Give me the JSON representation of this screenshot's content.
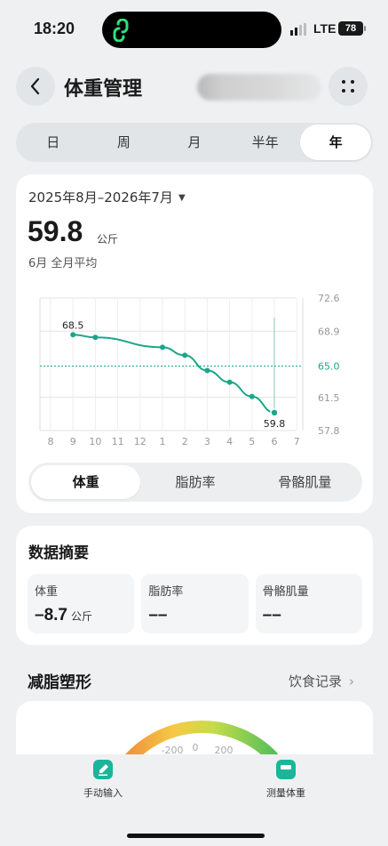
{
  "status_bar": {
    "time": "18:20",
    "network": "LTE",
    "battery": "78"
  },
  "header": {
    "title": "体重管理"
  },
  "period_tabs": [
    {
      "label": "日",
      "active": false
    },
    {
      "label": "周",
      "active": false
    },
    {
      "label": "月",
      "active": false
    },
    {
      "label": "半年",
      "active": false
    },
    {
      "label": "年",
      "active": true
    }
  ],
  "chart_card": {
    "date_range": "2025年8月–2026年7月",
    "value": "59.8",
    "unit": "公斤",
    "value_caption": "6月 全月平均"
  },
  "chart_data": {
    "type": "line",
    "x": [
      "8",
      "9",
      "10",
      "11",
      "12",
      "1",
      "2",
      "3",
      "4",
      "5",
      "6",
      "7"
    ],
    "series": [
      {
        "values": [
          null,
          68.5,
          68.2,
          null,
          null,
          67.1,
          66.2,
          64.5,
          63.2,
          61.6,
          59.8,
          null
        ]
      }
    ],
    "y_ticks": [
      "72.6",
      "68.9",
      "65.0",
      "61.5",
      "57.8"
    ],
    "ylim": [
      57.8,
      72.6
    ],
    "reference_line": {
      "value": 65.0,
      "label": "65.0"
    },
    "point_labels": [
      {
        "x": "9",
        "text": "68.5"
      },
      {
        "x": "6",
        "text": "59.8"
      }
    ],
    "grid": true,
    "color": "#1aa68a"
  },
  "metric_tabs": [
    {
      "label": "体重",
      "active": true
    },
    {
      "label": "脂肪率",
      "active": false
    },
    {
      "label": "骨骼肌量",
      "active": false
    }
  ],
  "summary": {
    "title": "数据摘要",
    "cells": [
      {
        "label": "体重",
        "value": "–8.7",
        "unit": "公斤"
      },
      {
        "label": "脂肪率",
        "value": "––",
        "unit": ""
      },
      {
        "label": "骨骼肌量",
        "value": "––",
        "unit": ""
      }
    ]
  },
  "fat_loss": {
    "title": "减脂塑形",
    "link": "饮食记录",
    "gauge_labels": [
      "-200",
      "0",
      "200"
    ]
  },
  "bottom_bar": {
    "manual_input": "手动输入",
    "measure": "测量体重"
  },
  "colors": {
    "accent": "#1aa68a",
    "background": "#eef0f2"
  }
}
